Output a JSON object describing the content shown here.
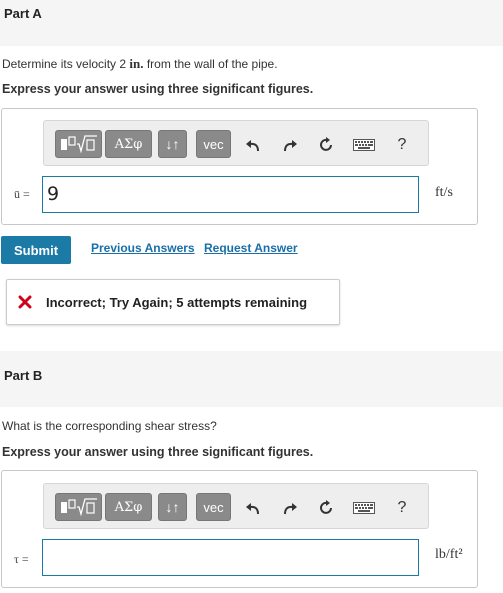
{
  "partA": {
    "title": "Part A",
    "question_prefix": "Determine its velocity 2 ",
    "question_unit": "in.",
    "question_suffix": " from the wall of the pipe.",
    "instruction": "Express your answer using three significant figures.",
    "toolbar": {
      "greek_label": "ΑΣφ",
      "arrows_label": "↓↑",
      "vec_label": "vec",
      "help_label": "?"
    },
    "variable_label": "ū =",
    "input_value": "9",
    "unit": "ft/s",
    "submit_label": "Submit",
    "previous_answers_label": "Previous Answers",
    "request_answer_label": "Request Answer",
    "feedback_text": "Incorrect; Try Again; 5 attempts remaining",
    "feedback_color": "#d0021b"
  },
  "partB": {
    "title": "Part B",
    "question": "What is the corresponding shear stress?",
    "instruction": "Express your answer using three significant figures.",
    "toolbar": {
      "greek_label": "ΑΣφ",
      "arrows_label": "↓↑",
      "vec_label": "vec",
      "help_label": "?"
    },
    "variable_label": "τ =",
    "input_value": "",
    "unit": "lb/ft²"
  },
  "colors": {
    "accent": "#1c7aa6",
    "link": "#1a6fa8",
    "toolbar_button": "#8a8a8a"
  },
  "icons": [
    "templates-icon",
    "undo-icon",
    "redo-icon",
    "reset-icon",
    "keyboard-icon",
    "help-icon",
    "incorrect-x-icon"
  ]
}
